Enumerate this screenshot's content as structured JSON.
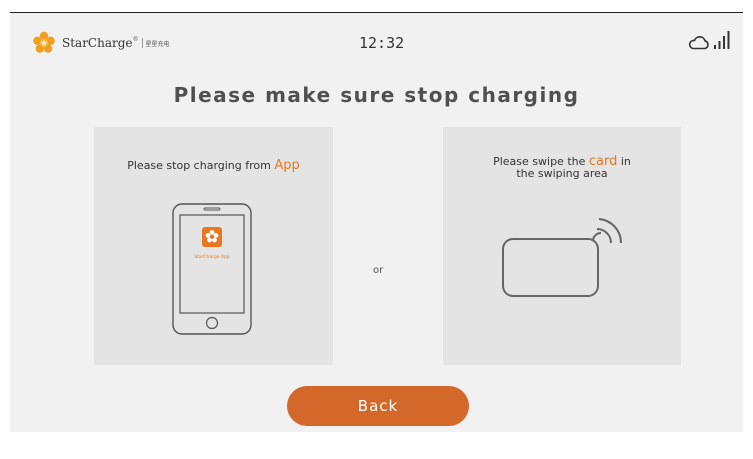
{
  "header": {
    "brand_name": "StarCharge",
    "brand_sup": "®",
    "brand_cn": "星星充电",
    "time": "12:32",
    "cloud_icon": "cloud-icon",
    "signal_icon": "signal-bars-icon"
  },
  "main": {
    "title": "Please make sure stop charging",
    "left_panel": {
      "text": "Please stop charging from ",
      "highlight": "App",
      "app_name": "StarCharge App",
      "phone_icon": "smartphone-icon"
    },
    "separator": "or",
    "right_panel": {
      "text_before": "Please swipe the ",
      "highlight": "card",
      "text_after": " in",
      "line2": "the swiping area",
      "card_icon": "nfc-card-icon"
    },
    "back_label": "Back"
  },
  "colors": {
    "accent": "#e87722",
    "button": "#d4682b",
    "background": "#f1f1f1",
    "panel": "#e4e4e4"
  }
}
